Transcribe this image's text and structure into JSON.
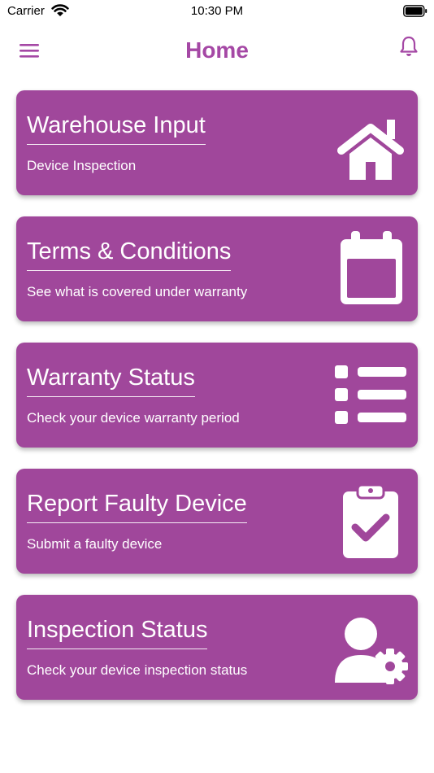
{
  "status_bar": {
    "carrier": "Carrier",
    "time": "10:30 PM"
  },
  "nav": {
    "title": "Home",
    "menu_icon": "hamburger-menu-icon",
    "bell_icon": "bell-icon"
  },
  "colors": {
    "accent": "#a548a5",
    "card_background": "#a0479b"
  },
  "cards": [
    {
      "title": "Warehouse Input",
      "subtitle": "Device Inspection",
      "icon": "home-icon"
    },
    {
      "title": "Terms & Conditions",
      "subtitle": "See what is covered under warranty",
      "icon": "calendar-icon"
    },
    {
      "title": "Warranty Status",
      "subtitle": "Check your device warranty period",
      "icon": "list-icon"
    },
    {
      "title": "Report Faulty Device",
      "subtitle": "Submit a faulty device",
      "icon": "clipboard-check-icon"
    },
    {
      "title": "Inspection Status",
      "subtitle": "Check your device inspection status",
      "icon": "user-gear-icon"
    }
  ]
}
